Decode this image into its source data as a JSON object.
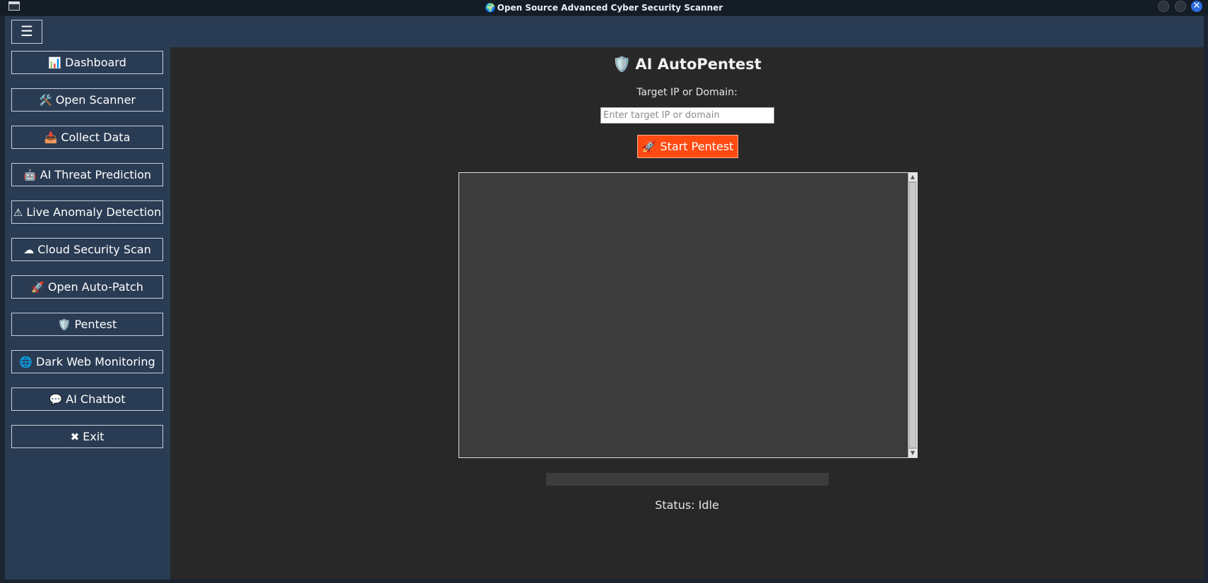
{
  "window": {
    "title": "Open Source Advanced Cyber Security Scanner",
    "title_icon": "🌍",
    "close_glyph": "✕"
  },
  "topbar": {
    "menu_glyph": "☰"
  },
  "sidebar": {
    "items": [
      {
        "icon": "📊",
        "label": "Dashboard"
      },
      {
        "icon": "🛠️",
        "label": "Open Scanner"
      },
      {
        "icon": "📥",
        "label": "Collect Data"
      },
      {
        "icon": "🤖",
        "label": "AI Threat Prediction"
      },
      {
        "icon": "⚠",
        "label": "Live Anomaly Detection"
      },
      {
        "icon": "☁",
        "label": "Cloud Security Scan"
      },
      {
        "icon": "🚀",
        "label": "Open Auto-Patch"
      },
      {
        "icon": "🛡️",
        "label": "Pentest"
      },
      {
        "icon": "🌐",
        "label": "Dark Web Monitoring"
      },
      {
        "icon": "💬",
        "label": "AI Chatbot"
      },
      {
        "icon": "✖",
        "label": "Exit"
      }
    ]
  },
  "main": {
    "title_icon": "🛡️",
    "title": "AI AutoPentest",
    "target_label": "Target IP or Domain:",
    "target_value": "",
    "target_placeholder": "Enter target IP or domain",
    "start_icon": "🚀",
    "start_label": "Start Pentest",
    "output_text": "",
    "progress": 0,
    "status": "Status: Idle"
  },
  "colors": {
    "sidebar_bg": "#2a3c53",
    "main_bg": "#282828",
    "start_button": "#ff4a12"
  }
}
